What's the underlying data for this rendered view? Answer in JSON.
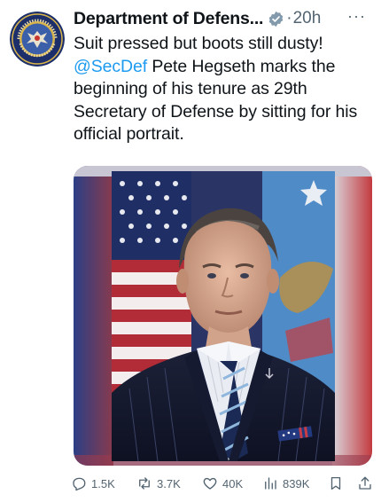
{
  "tweet": {
    "author_name": "Department of Defens...",
    "dot": "·",
    "time": "20h",
    "more": "···",
    "text_line1": "Suit pressed but boots still dusty!",
    "mention": "@SecDef",
    "text_rest": " Pete Hegseth marks the beginning of his tenure as 29th Secretary of Defense by sitting for his official portrait."
  },
  "stats": {
    "replies": "1.5K",
    "reposts": "3.7K",
    "likes": "40K",
    "views": "839K"
  },
  "colors": {
    "accent": "#1d9bf0",
    "secondary_text": "#536471",
    "primary_text": "#0f1419"
  },
  "icons": [
    "reply-icon",
    "repost-icon",
    "like-icon",
    "views-icon",
    "bookmark-icon",
    "share-icon",
    "verified-badge-icon",
    "more-icon"
  ]
}
